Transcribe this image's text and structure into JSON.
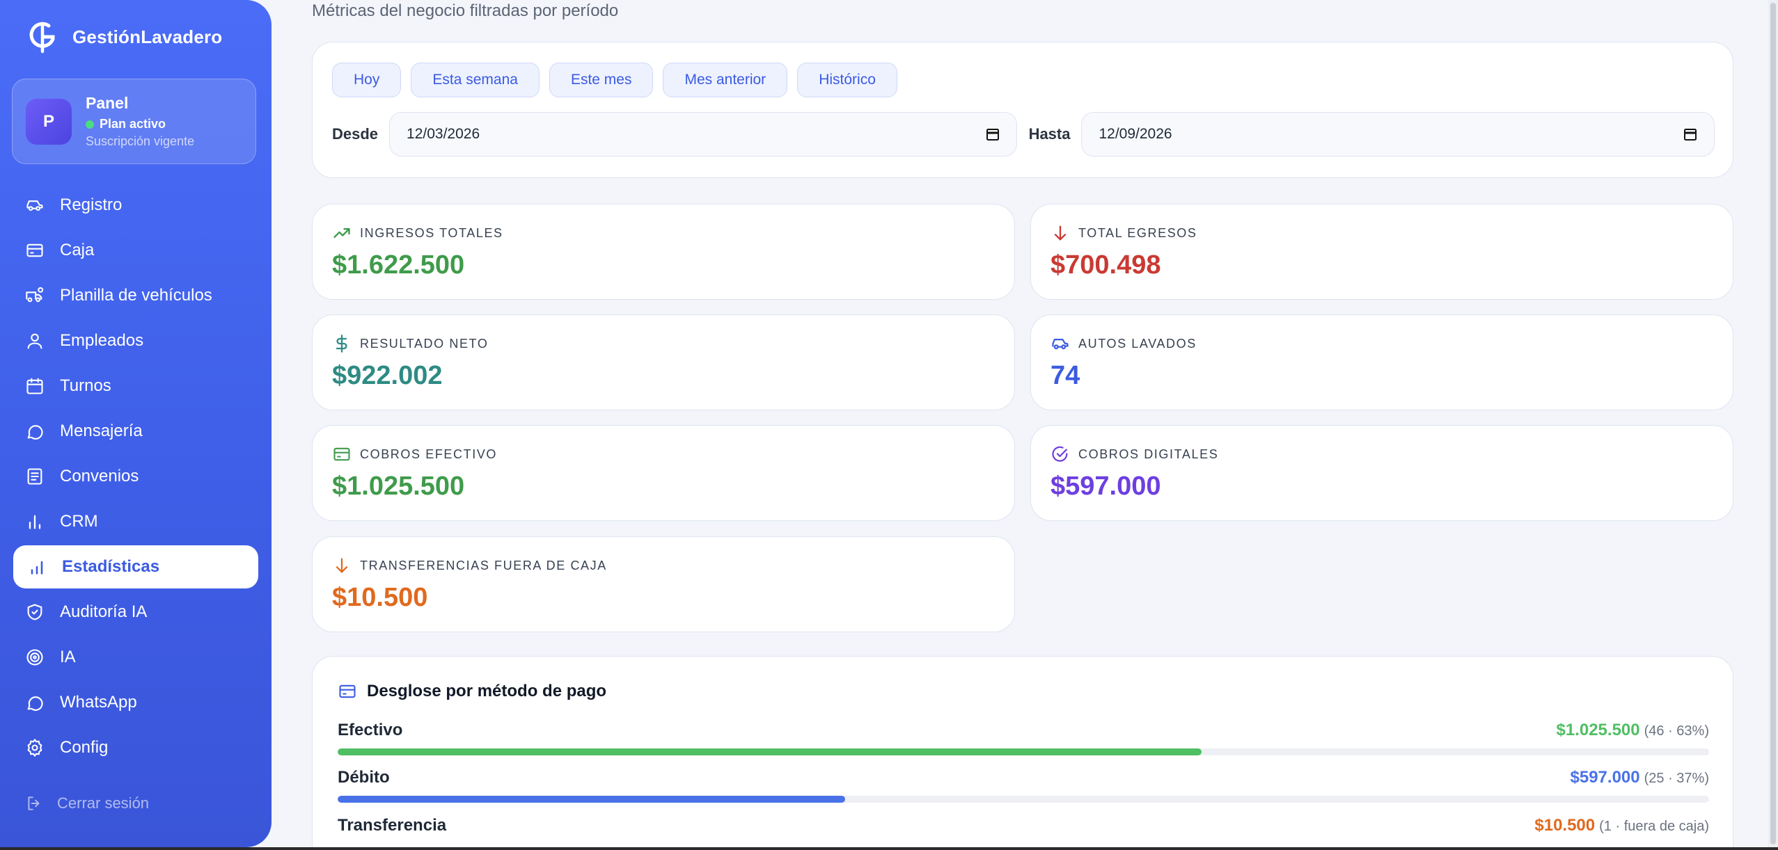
{
  "brand": {
    "name": "GestiónLavadero",
    "logo_icon": "g-logo-icon"
  },
  "panel": {
    "avatar": "P",
    "title": "Panel",
    "status": "Plan activo",
    "subtitle": "Suscripción vigente"
  },
  "nav": [
    {
      "label": "Registro",
      "icon": "car-icon"
    },
    {
      "label": "Caja",
      "icon": "wallet-icon"
    },
    {
      "label": "Planilla de vehículos",
      "icon": "truck-icon"
    },
    {
      "label": "Empleados",
      "icon": "user-icon"
    },
    {
      "label": "Turnos",
      "icon": "calendar-icon"
    },
    {
      "label": "Mensajería",
      "icon": "chat-icon"
    },
    {
      "label": "Convenios",
      "icon": "document-icon"
    },
    {
      "label": "CRM",
      "icon": "bar-chart-icon"
    },
    {
      "label": "Estadísticas",
      "icon": "stats-icon",
      "active": true
    },
    {
      "label": "Auditoría IA",
      "icon": "shield-check-icon"
    },
    {
      "label": "IA",
      "icon": "target-icon"
    },
    {
      "label": "WhatsApp",
      "icon": "whatsapp-icon"
    },
    {
      "label": "Config",
      "icon": "gear-icon"
    }
  ],
  "logout": "Cerrar sesión",
  "header": {
    "subtitle": "Métricas del negocio filtradas por período"
  },
  "filters": {
    "chips": [
      "Hoy",
      "Esta semana",
      "Este mes",
      "Mes anterior",
      "Histórico"
    ],
    "from_label": "Desde",
    "from_value": "12/03/2026",
    "to_label": "Hasta",
    "to_value": "12/09/2026"
  },
  "stats": [
    {
      "label": "INGRESOS TOTALES",
      "value": "$1.622.500",
      "color": "#3f9b4b",
      "icon": "trending-up-icon"
    },
    {
      "label": "TOTAL EGRESOS",
      "value": "$700.498",
      "color": "#c93a33",
      "icon": "arrow-down-icon"
    },
    {
      "label": "RESULTADO NETO",
      "value": "$922.002",
      "color": "#2e8b84",
      "icon": "dollar-icon"
    },
    {
      "label": "AUTOS LAVADOS",
      "value": "74",
      "color": "#3b5be0",
      "icon": "car-icon"
    },
    {
      "label": "COBROS EFECTIVO",
      "value": "$1.025.500",
      "color": "#3f9b4b",
      "icon": "card-icon"
    },
    {
      "label": "COBROS DIGITALES",
      "value": "$597.000",
      "color": "#6d3fe0",
      "icon": "check-circle-icon"
    },
    {
      "label": "TRANSFERENCIAS FUERA DE CAJA",
      "value": "$10.500",
      "color": "#e06a1f",
      "icon": "arrow-down-icon"
    }
  ],
  "breakdown": {
    "title": "Desglose por método de pago",
    "rows": [
      {
        "name": "Efectivo",
        "amount": "$1.025.500",
        "meta": "(46 · 63%)",
        "color": "#4fbf63",
        "percent": 63
      },
      {
        "name": "Débito",
        "amount": "$597.000",
        "meta": "(25 · 37%)",
        "color": "#4a72e8",
        "percent": 37
      },
      {
        "name": "Transferencia",
        "amount": "$10.500",
        "meta": "(1 · fuera de caja)",
        "color": "#e06a1f"
      }
    ]
  }
}
